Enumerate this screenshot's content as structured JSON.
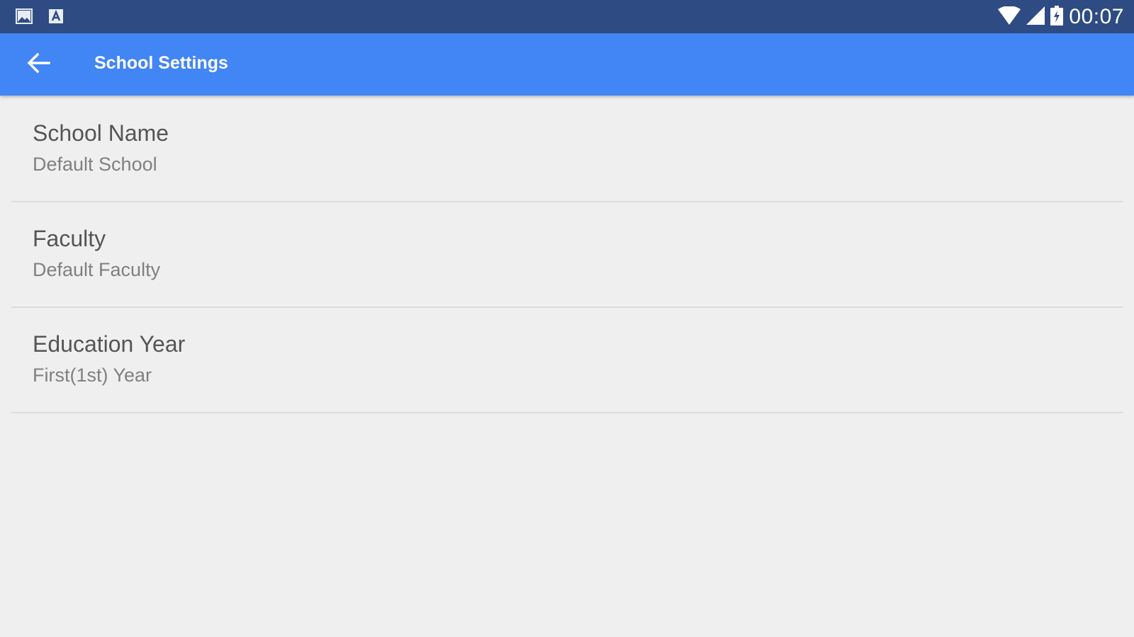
{
  "status_bar": {
    "time": "00:07",
    "left_icons": [
      "image-notification-icon",
      "font-notification-icon"
    ],
    "right_icons": [
      "wifi-icon",
      "signal-icon",
      "battery-icon"
    ]
  },
  "app_bar": {
    "title": "School Settings",
    "back_icon": "arrow-back-icon",
    "color": "#4285f4"
  },
  "settings": [
    {
      "title": "School Name",
      "value": "Default School"
    },
    {
      "title": "Faculty",
      "value": "Default Faculty"
    },
    {
      "title": "Education Year",
      "value": "First(1st) Year"
    }
  ],
  "colors": {
    "status_bar": "#2e4c83",
    "background": "#efefef",
    "title_text": "#555555",
    "value_text": "#808080"
  }
}
